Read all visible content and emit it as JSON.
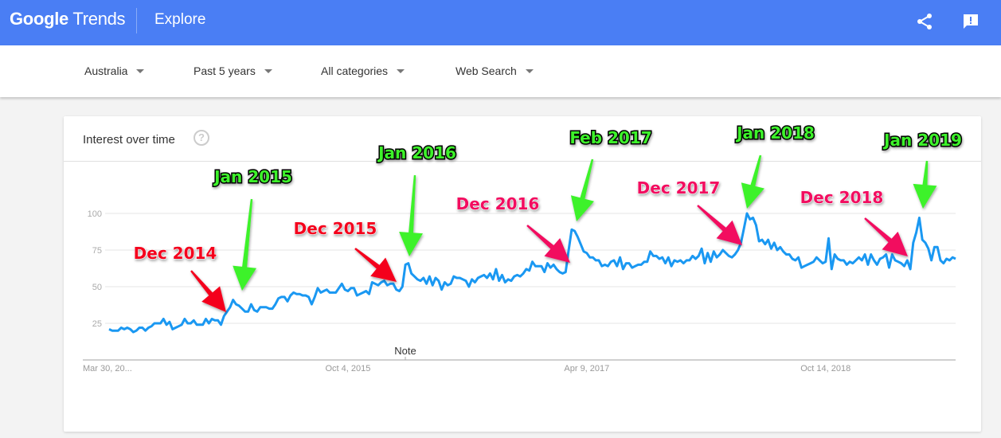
{
  "header": {
    "logo_google": "Google",
    "logo_trends": "Trends",
    "section": "Explore",
    "icons": [
      "share-icon",
      "feedback-icon"
    ]
  },
  "filters": [
    {
      "label": "Australia"
    },
    {
      "label": "Past 5 years"
    },
    {
      "label": "All categories"
    },
    {
      "label": "Web Search"
    }
  ],
  "card": {
    "title": "Interest over time",
    "help_glyph": "?",
    "note_label": "Note"
  },
  "colors": {
    "header_bg": "#4a7ef4",
    "line": "#1a98f2",
    "annotation_red": "#f4051f",
    "annotation_pink": "#f2075f",
    "annotation_green": "#3df22b"
  },
  "chart_data": {
    "type": "line",
    "title": "Interest over time",
    "xlabel": "",
    "ylabel": "",
    "ylim": [
      0,
      100
    ],
    "yticks": [
      25,
      50,
      75,
      100
    ],
    "xticks": [
      "Mar 30, 20...",
      "Oct 4, 2015",
      "Apr 9, 2017",
      "Oct 14, 2018"
    ],
    "xtick_index": [
      0,
      79,
      158,
      237
    ],
    "grid": true,
    "legend": "none",
    "series": [
      {
        "name": "Interest",
        "values": [
          21,
          20,
          20,
          20,
          22,
          21,
          22,
          21,
          19,
          20,
          22,
          22,
          20,
          22,
          23,
          25,
          25,
          25,
          28,
          24,
          26,
          21,
          22,
          23,
          24,
          28,
          25,
          25,
          27,
          24,
          24,
          24,
          28,
          25,
          28,
          27,
          27,
          24,
          30,
          33,
          36,
          41,
          38,
          37,
          35,
          33,
          33,
          38,
          34,
          33,
          36,
          36,
          36,
          35,
          35,
          38,
          42,
          43,
          43,
          40,
          44,
          46,
          45,
          45,
          44,
          44,
          43,
          38,
          43,
          49,
          46,
          47,
          48,
          46,
          46,
          46,
          49,
          52,
          48,
          47,
          49,
          49,
          44,
          45,
          46,
          47,
          45,
          53,
          52,
          51,
          53,
          54,
          51,
          52,
          52,
          48,
          47,
          50,
          65,
          66,
          59,
          57,
          55,
          54,
          56,
          52,
          57,
          51,
          56,
          54,
          48,
          53,
          51,
          52,
          57,
          56,
          56,
          55,
          54,
          50,
          55,
          53,
          56,
          57,
          58,
          56,
          59,
          55,
          62,
          54,
          58,
          53,
          55,
          54,
          57,
          58,
          57,
          59,
          62,
          61,
          67,
          64,
          64,
          64,
          60,
          66,
          63,
          65,
          62,
          60,
          59,
          60,
          75,
          89,
          88,
          84,
          79,
          74,
          73,
          70,
          70,
          68,
          68,
          64,
          65,
          64,
          67,
          68,
          64,
          70,
          62,
          66,
          66,
          63,
          64,
          65,
          65,
          67,
          67,
          74,
          71,
          71,
          69,
          70,
          66,
          70,
          64,
          68,
          67,
          68,
          66,
          68,
          68,
          71,
          69,
          71,
          76,
          66,
          73,
          67,
          74,
          70,
          72,
          75,
          73,
          71,
          70,
          72,
          75,
          80,
          90,
          100,
          96,
          97,
          92,
          81,
          82,
          79,
          82,
          76,
          80,
          75,
          77,
          74,
          72,
          72,
          69,
          68,
          70,
          63,
          64,
          65,
          66,
          67,
          70,
          68,
          66,
          67,
          83,
          62,
          72,
          69,
          68,
          68,
          65,
          67,
          66,
          68,
          70,
          68,
          72,
          65,
          72,
          68,
          65,
          69,
          70,
          72,
          63,
          72,
          68,
          67,
          66,
          64,
          68,
          62,
          80,
          87,
          97,
          82,
          80,
          76,
          68,
          77,
          77,
          68,
          66,
          69,
          68,
          70,
          69
        ]
      }
    ],
    "annotations": [
      {
        "text": "Dec 2014",
        "color": "red",
        "kind": "dip"
      },
      {
        "text": "Jan 2015",
        "color": "green",
        "kind": "peak"
      },
      {
        "text": "Dec 2015",
        "color": "red",
        "kind": "dip"
      },
      {
        "text": "Jan 2016",
        "color": "green",
        "kind": "peak"
      },
      {
        "text": "Dec 2016",
        "color": "pink",
        "kind": "dip"
      },
      {
        "text": "Feb 2017",
        "color": "green",
        "kind": "peak"
      },
      {
        "text": "Dec 2017",
        "color": "pink",
        "kind": "dip"
      },
      {
        "text": "Jan 2018",
        "color": "green",
        "kind": "peak"
      },
      {
        "text": "Dec 2018",
        "color": "pink",
        "kind": "dip"
      },
      {
        "text": "Jan 2019",
        "color": "green",
        "kind": "peak"
      }
    ]
  }
}
